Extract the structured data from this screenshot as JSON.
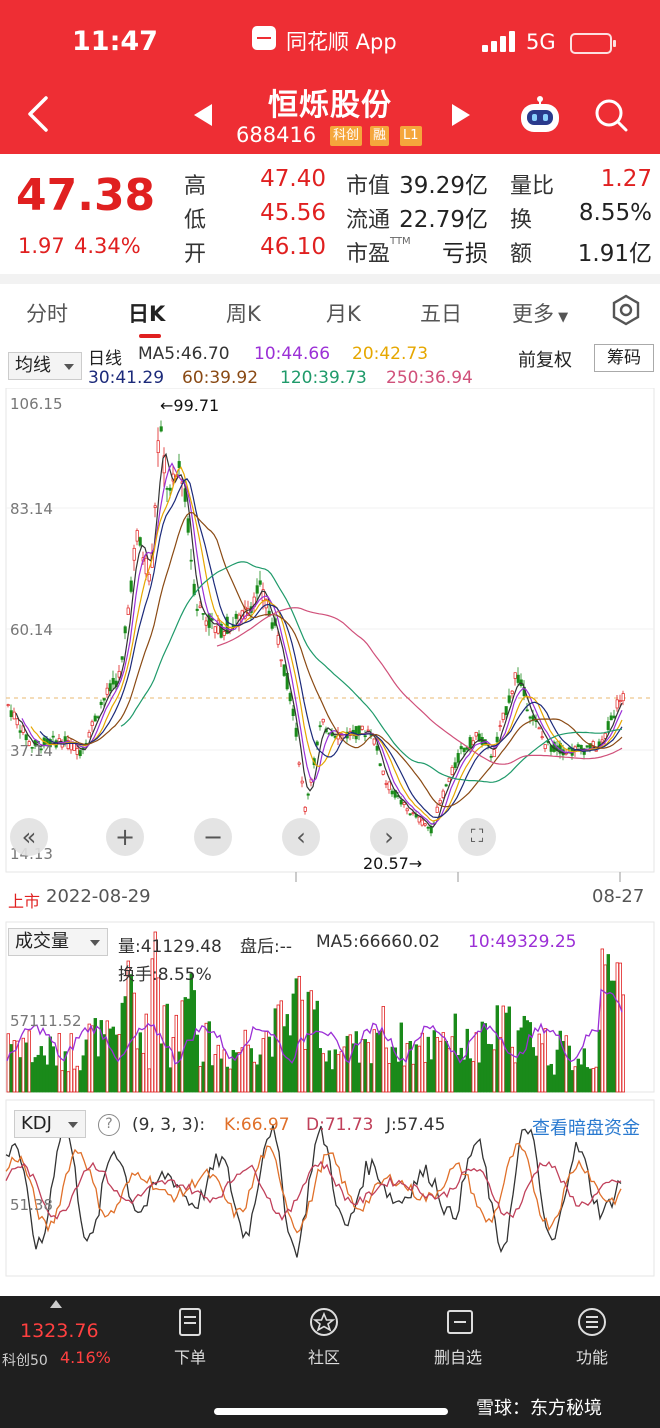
{
  "status": {
    "time": "11:47",
    "app": "同花顺 App",
    "network": "5G"
  },
  "stock": {
    "name": "恒烁股份",
    "code": "688416",
    "tags": [
      "科创",
      "融",
      "L1"
    ]
  },
  "quote": {
    "price": "47.38",
    "change": "1.97",
    "change_pct": "4.34%",
    "high_label": "高",
    "high": "47.40",
    "low_label": "低",
    "low": "45.56",
    "open_label": "开",
    "open": "46.10",
    "mktcap_label": "市值",
    "mktcap": "39.29亿",
    "float_label": "流通",
    "float_cap": "22.79亿",
    "pe_label": "市盈",
    "pe_suffix": "TTM",
    "pe": "亏损",
    "vol_ratio_label": "量比",
    "vol_ratio": "1.27",
    "turnover_label": "换",
    "turnover": "8.55%",
    "amount_label": "额",
    "amount": "1.91亿"
  },
  "tabs": [
    "分时",
    "日K",
    "周K",
    "月K",
    "五日",
    "更多"
  ],
  "active_tab": "日K",
  "kline": {
    "indicator": "均线",
    "period": "日线",
    "ma5": "MA5:46.70",
    "ma10": "10:44.66",
    "ma20": "20:42.73",
    "ma30": "30:41.29",
    "ma60": "60:39.92",
    "ma120": "120:39.73",
    "ma250": "250:36.94",
    "adjust": "前复权",
    "chips": "筹码",
    "y_ticks": [
      "106.15",
      "83.14",
      "60.14",
      "37.14",
      "14.13"
    ],
    "high_marker": "←99.71",
    "low_marker": "20.57→",
    "listed_label": "上市",
    "start_date": "2022-08-29",
    "end_date": "08-27"
  },
  "volume": {
    "indicator": "成交量",
    "vol": "量:41129.48",
    "after": "盘后:--",
    "ma5": "MA5:66660.02",
    "ma10": "10:49329.25",
    "turnover": "换手:8.55%",
    "y_tick": "57111.52"
  },
  "kdj": {
    "indicator": "KDJ",
    "params": "(9, 3, 3):",
    "k": "K:66.97",
    "d": "D:71.73",
    "j": "J:57.45",
    "link": "查看暗盘资金",
    "y_tick": "51.38"
  },
  "footer": {
    "index_value": "1323.76",
    "index_name": "科创50",
    "index_pct": "4.16%",
    "items": [
      "下单",
      "社区",
      "删自选",
      "功能"
    ],
    "watermark": "雪球：东方秘境"
  },
  "colors": {
    "brand_red": "#ee2e34",
    "up": "#e02020",
    "down": "#1a8a1a"
  }
}
